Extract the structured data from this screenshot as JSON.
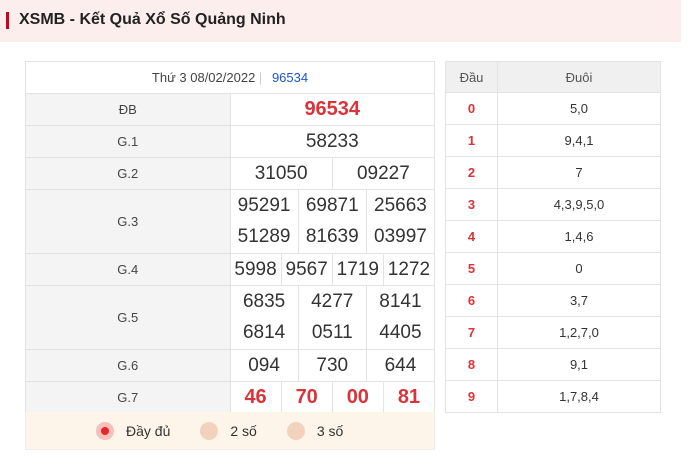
{
  "header": {
    "title": "XSMB - Kết Quả Xổ Số Quảng Ninh"
  },
  "result": {
    "date": "Thứ 3 08/02/2022",
    "code": "96534",
    "labels": [
      "ĐB",
      "G.1",
      "G.2",
      "G.3",
      "G.4",
      "G.5",
      "G.6",
      "G.7"
    ],
    "db": "96534",
    "g1": "58233",
    "g2": [
      "31050",
      "09227"
    ],
    "g3": [
      "95291",
      "69871",
      "25663",
      "51289",
      "81639",
      "03997"
    ],
    "g4": [
      "5998",
      "9567",
      "1719",
      "1272"
    ],
    "g5": [
      "6835",
      "4277",
      "8141",
      "6814",
      "0511",
      "4405"
    ],
    "g6": [
      "094",
      "730",
      "644"
    ],
    "g7": [
      "46",
      "70",
      "00",
      "81"
    ]
  },
  "options": [
    "Đầy đủ",
    "2 số",
    "3 số"
  ],
  "loto": {
    "headers": [
      "Đầu",
      "Đuôi"
    ],
    "rows": [
      {
        "dau": "0",
        "duoi": "5,0"
      },
      {
        "dau": "1",
        "duoi": "9,4,1"
      },
      {
        "dau": "2",
        "duoi": "7"
      },
      {
        "dau": "3",
        "duoi": "4,3,9,5,0"
      },
      {
        "dau": "4",
        "duoi": "1,4,6"
      },
      {
        "dau": "5",
        "duoi": "0"
      },
      {
        "dau": "6",
        "duoi": "3,7"
      },
      {
        "dau": "7",
        "duoi": "1,2,7,0"
      },
      {
        "dau": "8",
        "duoi": "9,1"
      },
      {
        "dau": "9",
        "duoi": "1,7,8,4"
      }
    ]
  },
  "colors": {
    "accent": "#d9343a",
    "header_bg": "#fdeeee",
    "code": "#1a56c8"
  }
}
